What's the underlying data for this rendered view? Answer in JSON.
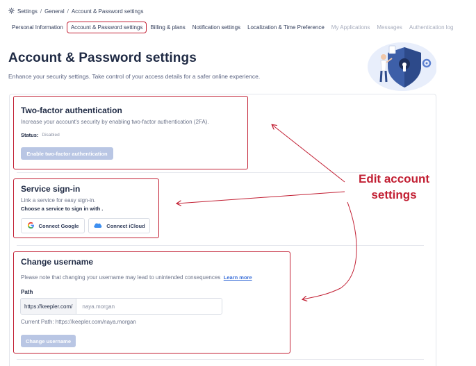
{
  "breadcrumb": {
    "root": "Settings",
    "middle": "General",
    "current": "Account & Password settings",
    "separator": "/"
  },
  "tabs": [
    {
      "label": "Personal Information",
      "state": "normal"
    },
    {
      "label": "Account & Password settings",
      "state": "active"
    },
    {
      "label": "Billing & plans",
      "state": "normal"
    },
    {
      "label": "Notification settings",
      "state": "normal"
    },
    {
      "label": "Localization & Time Preference",
      "state": "normal"
    },
    {
      "label": "My Applications",
      "state": "dim"
    },
    {
      "label": "Messages",
      "state": "dim"
    },
    {
      "label": "Authentication log",
      "state": "dim"
    }
  ],
  "page": {
    "title": "Account & Password settings",
    "subtitle": "Enhance your security settings. Take control of your access details for a safer online experience."
  },
  "two_factor": {
    "title": "Two-factor authentication",
    "description": "Increase your account's security by enabling two-factor authentication (2FA).",
    "status_label": "Status:",
    "status_value": "Disabled",
    "button_label": "Enable two-factor authentication"
  },
  "service_signin": {
    "title": "Service sign-in",
    "description": "Link a service for easy sign-in.",
    "prompt": "Choose a service to sign in with .",
    "google_label": "Connect Google",
    "icloud_label": "Connect iCloud"
  },
  "change_username": {
    "title": "Change username",
    "description": "Please note that changing your username may lead to unintended consequences",
    "learn_more": "Learn more",
    "path_label": "Path",
    "path_prefix": "https://keepler.com/",
    "path_value": "naya.morgan",
    "current_path": "Current Path: https://keepler.com/naya.morgan",
    "button_label": "Change username"
  },
  "annotation": {
    "text_line1": "Edit account",
    "text_line2": "settings",
    "color": "#c21f33"
  },
  "colors": {
    "accent": "#3b6fd8",
    "highlight": "#c21f33",
    "disabled_button": "#b9c6e4"
  }
}
